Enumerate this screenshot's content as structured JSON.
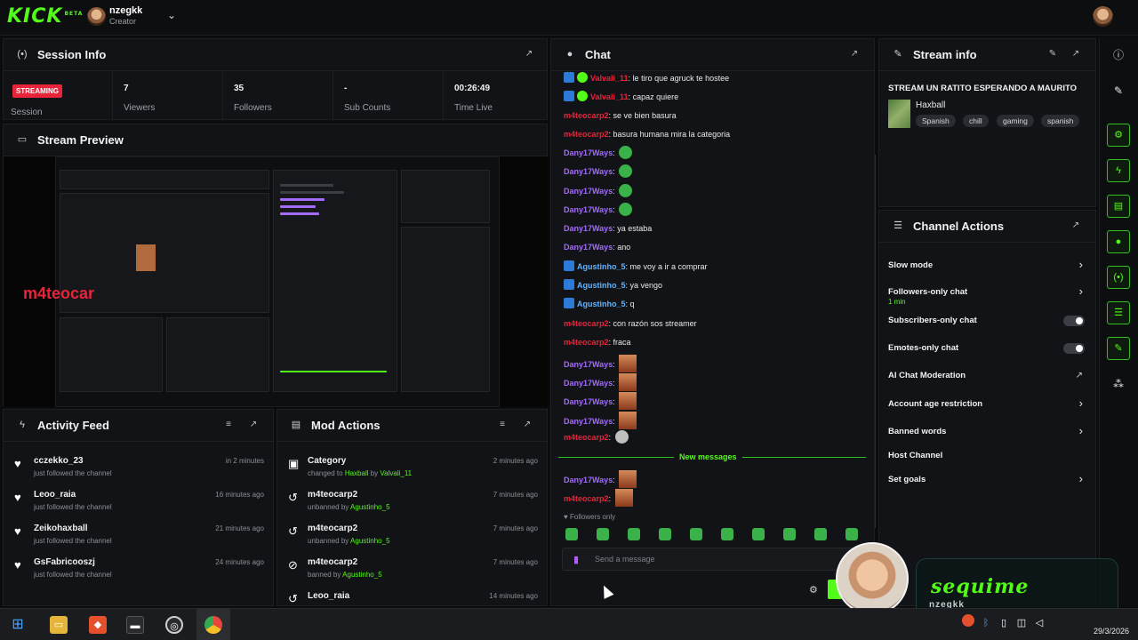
{
  "topbar": {
    "logo": "KICK",
    "logo_tag": "BETA",
    "username": "nzegkk",
    "role": "Creator"
  },
  "session": {
    "title": "Session Info",
    "live_badge": "STREAMING",
    "session_label": "Session",
    "stats": [
      {
        "value": "7",
        "label": "Viewers"
      },
      {
        "value": "35",
        "label": "Followers"
      },
      {
        "value": "-",
        "label": "Sub Counts"
      },
      {
        "value": "00:26:49",
        "label": "Time Live"
      }
    ]
  },
  "preview": {
    "title": "Stream Preview",
    "overlay_text": "m4teocar"
  },
  "activity": {
    "title": "Activity Feed",
    "items": [
      {
        "name": "cczekko_23",
        "sub": "just followed the channel",
        "time": "in 2 minutes"
      },
      {
        "name": "Leoo_raia",
        "sub": "just followed the channel",
        "time": "16 minutes ago"
      },
      {
        "name": "Zeikohaxball",
        "sub": "just followed the channel",
        "time": "21 minutes ago"
      },
      {
        "name": "GsFabricooszj",
        "sub": "just followed the channel",
        "time": "24 minutes ago"
      }
    ]
  },
  "mod": {
    "title": "Mod Actions",
    "items": [
      {
        "name": "Category",
        "pre": "changed to ",
        "hl1": "Haxball",
        "mid": " by ",
        "hl2": "Valvali_11",
        "time": "2 minutes ago",
        "icon": "calendar"
      },
      {
        "name": "m4teocarp2",
        "pre": "unbanned by ",
        "hl1": "Agustinho_5",
        "mid": "",
        "hl2": "",
        "time": "7 minutes ago",
        "icon": "undo"
      },
      {
        "name": "m4teocarp2",
        "pre": "unbanned by ",
        "hl1": "Agustinho_5",
        "mid": "",
        "hl2": "",
        "time": "7 minutes ago",
        "icon": "undo"
      },
      {
        "name": "m4teocarp2",
        "pre": "banned by ",
        "hl1": "Agustinho_5",
        "mid": "",
        "hl2": "",
        "time": "7 minutes ago",
        "icon": "ban"
      },
      {
        "name": "Leoo_raia",
        "pre": "",
        "hl1": "",
        "mid": "",
        "hl2": "",
        "time": "14 minutes ago",
        "icon": "undo"
      }
    ]
  },
  "chat": {
    "title": "Chat",
    "messages": [
      {
        "user": "Valvali_11",
        "color": "red",
        "badges": [
          "mod",
          "verified"
        ],
        "text": "le tiro que agruck te hostee"
      },
      {
        "user": "Valvali_11",
        "color": "red",
        "badges": [
          "mod",
          "verified"
        ],
        "text": "capaz quiere"
      },
      {
        "user": "m4teocarp2",
        "color": "red",
        "badges": [],
        "text": "se ve bien basura"
      },
      {
        "user": "m4teocarp2",
        "color": "red",
        "badges": [],
        "text": "basura humana mira la categoria"
      },
      {
        "user": "Dany17Ways",
        "color": "purple",
        "badges": [],
        "text": "",
        "emote": "green"
      },
      {
        "user": "Dany17Ways",
        "color": "purple",
        "badges": [],
        "text": "",
        "emote": "green"
      },
      {
        "user": "Dany17Ways",
        "color": "purple",
        "badges": [],
        "text": "",
        "emote": "green"
      },
      {
        "user": "Dany17Ways",
        "color": "purple",
        "badges": [],
        "text": "",
        "emote": "green"
      },
      {
        "user": "Dany17Ways",
        "color": "purple",
        "badges": [],
        "text": "ya estaba"
      },
      {
        "user": "Dany17Ways",
        "color": "purple",
        "badges": [],
        "text": "ano"
      },
      {
        "user": "Agustinho_5",
        "color": "blue",
        "badges": [
          "mod"
        ],
        "text": "me voy a ir a comprar"
      },
      {
        "user": "Agustinho_5",
        "color": "blue",
        "badges": [
          "mod"
        ],
        "text": "ya vengo"
      },
      {
        "user": "Agustinho_5",
        "color": "blue",
        "badges": [
          "mod"
        ],
        "text": "q"
      },
      {
        "user": "m4teocarp2",
        "color": "red",
        "badges": [],
        "text": "con razón sos streamer"
      },
      {
        "user": "m4teocarp2",
        "color": "red",
        "badges": [],
        "text": "fraca"
      },
      {
        "user": "Dany17Ways",
        "color": "purple",
        "badges": [],
        "text": "",
        "emote": "face"
      },
      {
        "user": "Dany17Ways",
        "color": "purple",
        "badges": [],
        "text": "",
        "emote": "face"
      },
      {
        "user": "Dany17Ways",
        "color": "purple",
        "badges": [],
        "text": "",
        "emote": "face"
      },
      {
        "user": "Dany17Ways",
        "color": "purple",
        "badges": [],
        "text": "",
        "emote": "face"
      },
      {
        "user": "m4teocarp2",
        "color": "red",
        "badges": [],
        "text": "",
        "emote": "spark"
      }
    ],
    "new_messages_label": "New messages",
    "new_messages": [
      {
        "user": "Dany17Ways",
        "color": "purple",
        "text": "",
        "emote": "face"
      },
      {
        "user": "m4teocarp2",
        "color": "red",
        "text": "",
        "emote": "face"
      }
    ],
    "followers_only": "Followers only",
    "input_placeholder": "Send a message"
  },
  "stream_info": {
    "title": "Stream info",
    "stream_title": "STREAM UN RATITO ESPERANDO A MAURITO",
    "category": "Haxball",
    "tags": [
      "Spanish",
      "chill",
      "gaming",
      "spanish"
    ]
  },
  "channel_actions": {
    "title": "Channel Actions",
    "rows": [
      {
        "label": "Slow mode",
        "sub": "",
        "control": "chevron"
      },
      {
        "label": "Followers-only chat",
        "sub": "1 min",
        "control": "chevron"
      },
      {
        "label": "Subscribers-only chat",
        "sub": "",
        "control": "toggle"
      },
      {
        "label": "Emotes-only chat",
        "sub": "",
        "control": "toggle"
      },
      {
        "label": "AI Chat Moderation",
        "sub": "",
        "control": "external"
      },
      {
        "label": "Account age restriction",
        "sub": "",
        "control": "chevron"
      },
      {
        "label": "Banned words",
        "sub": "",
        "control": "chevron"
      },
      {
        "label": "Host Channel",
        "sub": "",
        "control": "none"
      },
      {
        "label": "Set goals",
        "sub": "",
        "control": "chevron"
      }
    ]
  },
  "overlay": {
    "follow_text": "sequime",
    "follow_user": "nzegkk"
  },
  "taskbar": {
    "clock_date": "29/3/2026"
  },
  "colors": {
    "accent": "#53fc18",
    "live": "#e8243a",
    "mod_badge": "#2d7bd6",
    "panel_bg": "#121316"
  }
}
